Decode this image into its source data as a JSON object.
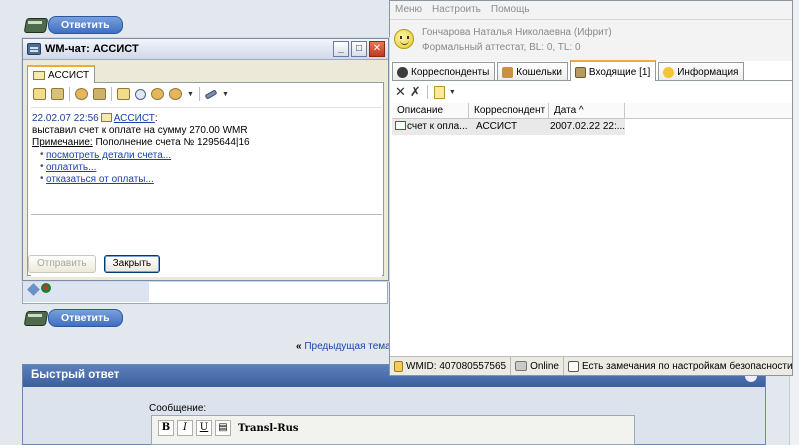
{
  "forum": {
    "reply_button_label": "Ответить",
    "prev_topic_arrow": "«",
    "prev_topic_link": "Предыдущая тема",
    "quick_reply": {
      "title": "Быстрый ответ",
      "message_label": "Сообщение:",
      "toolbar": {
        "bold": "B",
        "italic": "I",
        "underline": "U",
        "translit": "Transl-Rus"
      }
    }
  },
  "wm_main": {
    "menu": [
      "Меню",
      "Настроить",
      "Помощь"
    ],
    "user_name": "Гончарова Наталья Николаевна (Ифрит)",
    "user_attestat": "Формальный аттестат, BL: 0, TL: 0",
    "tabs": [
      {
        "label": "Корреспонденты",
        "active": false
      },
      {
        "label": "Кошельки",
        "active": false
      },
      {
        "label": "Входящие [1]",
        "active": true
      },
      {
        "label": "Информация",
        "active": false
      }
    ],
    "grid": {
      "columns": [
        "Описание",
        "Корреспондент",
        "Дата ^"
      ],
      "rows": [
        {
          "description": "счет к опла...",
          "correspondent": "АССИСТ",
          "date": "2007.02.22 22:..."
        }
      ]
    },
    "status": {
      "wmid": "WMID: 407080557565",
      "online": "Online",
      "security": "Есть замечания по настройкам безопасности"
    }
  },
  "wm_chat": {
    "title": "WM-чат: АССИСТ",
    "tab_label": "АССИСТ",
    "message": {
      "datetime": "22.02.07 22:56",
      "sender": "АССИСТ",
      "sender_suffix": ":",
      "body": "выставил счет к оплате на сумму 270.00 WMR",
      "note_label": "Примечание:",
      "note_text": " Пополнение счета № 1295644|16",
      "links": [
        "посмотреть детали счета...",
        "оплатить...",
        "отказаться от оплаты..."
      ]
    },
    "buttons": {
      "send": "Отправить",
      "close": "Закрыть"
    }
  }
}
